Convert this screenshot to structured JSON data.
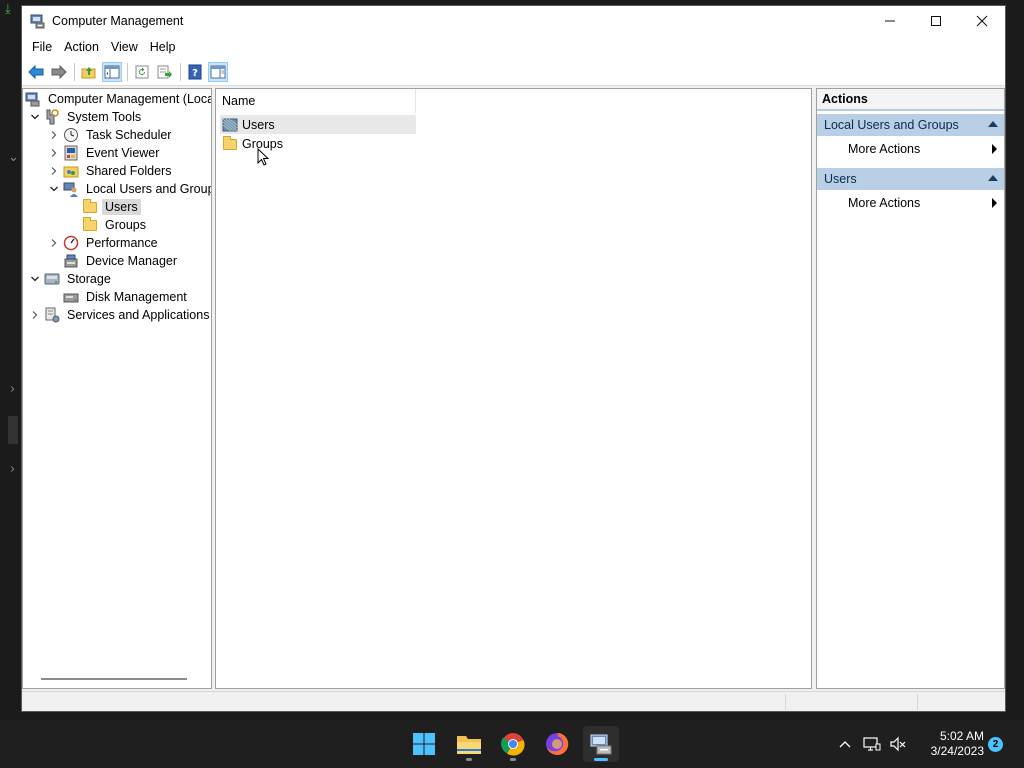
{
  "window": {
    "title": "Computer Management",
    "controls": {
      "minimize": "minimize",
      "maximize": "maximize",
      "close": "close"
    }
  },
  "menubar": {
    "items": [
      "File",
      "Action",
      "View",
      "Help"
    ]
  },
  "toolbar": {
    "buttons": [
      "back-icon",
      "forward-icon",
      "up-folder-icon",
      "show-hide-tree-icon",
      "refresh-icon",
      "export-list-icon",
      "help-icon",
      "show-hide-action-pane-icon"
    ]
  },
  "tree": {
    "items": [
      {
        "label": "Computer Management (Local",
        "icon": "computer-management-icon",
        "expander": ""
      },
      {
        "label": "System Tools",
        "icon": "system-tools-icon",
        "expander": "expanded"
      },
      {
        "label": "Task Scheduler",
        "icon": "clock-icon",
        "expander": "collapsed"
      },
      {
        "label": "Event Viewer",
        "icon": "event-viewer-icon",
        "expander": "collapsed"
      },
      {
        "label": "Shared Folders",
        "icon": "shared-folder-icon",
        "expander": "collapsed"
      },
      {
        "label": "Local Users and Groups",
        "icon": "users-groups-icon",
        "expander": "expanded"
      },
      {
        "label": "Users",
        "icon": "folder-icon",
        "expander": "",
        "selected": true
      },
      {
        "label": "Groups",
        "icon": "folder-icon",
        "expander": ""
      },
      {
        "label": "Performance",
        "icon": "performance-icon",
        "expander": "collapsed"
      },
      {
        "label": "Device Manager",
        "icon": "device-manager-icon",
        "expander": ""
      },
      {
        "label": "Storage",
        "icon": "storage-icon",
        "expander": "expanded"
      },
      {
        "label": "Disk Management",
        "icon": "disk-management-icon",
        "expander": ""
      },
      {
        "label": "Services and Applications",
        "icon": "services-icon",
        "expander": "collapsed"
      }
    ]
  },
  "list": {
    "column_header": "Name",
    "rows": [
      {
        "label": "Users",
        "icon": "users-folder-icon"
      },
      {
        "label": "Groups",
        "icon": "folder-icon"
      }
    ]
  },
  "actions": {
    "header": "Actions",
    "sections": [
      {
        "title": "Local Users and Groups",
        "item": "More Actions"
      },
      {
        "title": "Users",
        "item": "More Actions"
      }
    ]
  },
  "taskbar": {
    "apps": [
      "start-icon",
      "file-explorer-icon",
      "chrome-icon",
      "firefox-icon",
      "computer-management-icon"
    ],
    "time": "5:02 AM",
    "date": "3/24/2023",
    "notifications": "2"
  },
  "colors": {
    "selection": "#d9d9d9",
    "action_section": "#b8cfe6",
    "accent": "#4cc2ff",
    "taskbar": "#1f1f1f"
  }
}
